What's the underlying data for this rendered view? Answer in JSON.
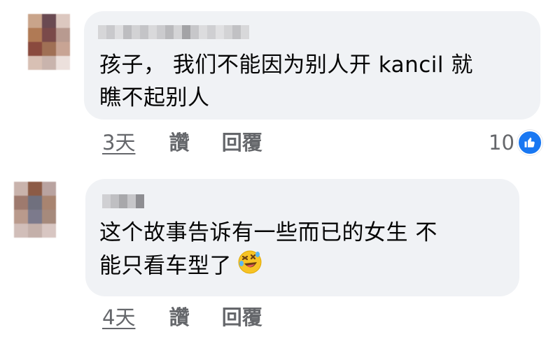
{
  "comments": [
    {
      "text_line1": "孩子， 我们不能因为别人开 kancil 就",
      "text_line2": "瞧不起别人",
      "time": "3天",
      "like_label": "讚",
      "reply_label": "回覆",
      "reaction_count": "10",
      "reaction_icon": "thumbs-up-icon"
    },
    {
      "text_line1": "这个故事告诉有一些而已的女生 不",
      "text_line2": "能只看车型了",
      "emoji_icon": "rolling-on-floor-laughing-icon",
      "time": "4天",
      "like_label": "讚",
      "reply_label": "回覆"
    }
  ],
  "colors": {
    "bubble": "#f0f2f5",
    "text": "#050505",
    "meta": "#65676b",
    "like_badge": "#1877f2"
  }
}
